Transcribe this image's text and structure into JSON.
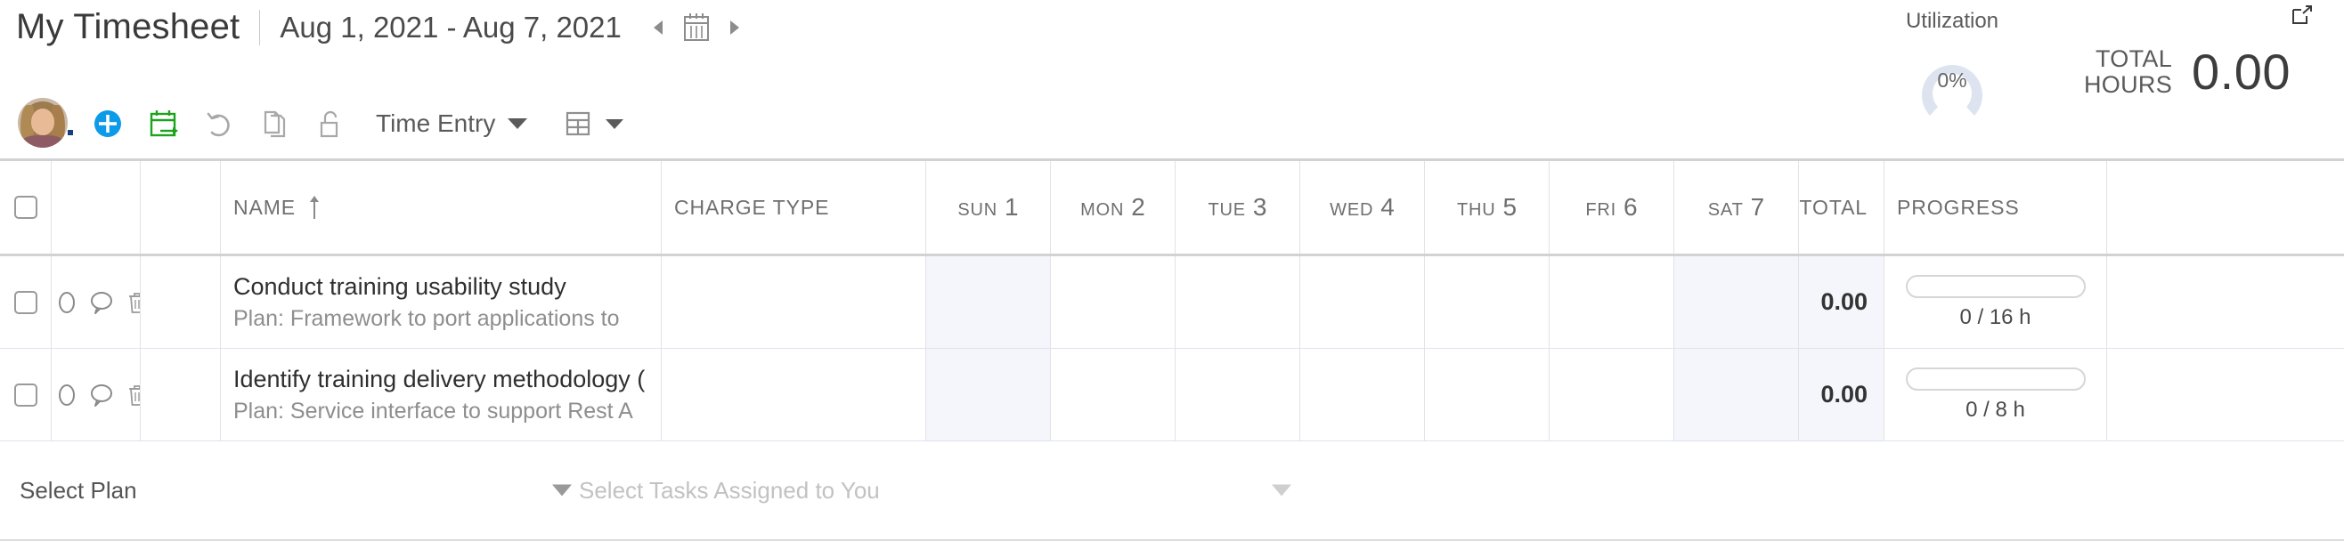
{
  "header": {
    "app_title": "My Timesheet",
    "date_range": "Aug 1, 2021 - Aug 7, 2021",
    "prev_icon": "chevron-left-icon",
    "calendar_icon": "calendar-icon",
    "next_icon": "chevron-right-icon",
    "expand_icon": "expand-window-icon"
  },
  "utilization": {
    "label": "Utilization",
    "percent_text": "0%",
    "percent_value": 0,
    "arc_color": "#dde4f0"
  },
  "totals": {
    "label_line1": "TOTAL",
    "label_line2": "HOURS",
    "value": "0.00"
  },
  "toolbar": {
    "avatar_name": "user-avatar",
    "add_label": "add-entry",
    "add_color": "#0d9ae8",
    "calendar_label": "copy-from-calendar",
    "calendar_color": "#1ca21c",
    "undo_label": "undo",
    "copy_label": "copy",
    "lock_label": "lock",
    "view_dropdown": "Time Entry",
    "grid_dropdown_label": "layout-options"
  },
  "grid": {
    "columns": {
      "name": "NAME",
      "charge_type": "CHARGE TYPE",
      "total": "TOTAL",
      "progress": "PROGRESS"
    },
    "days": [
      {
        "dow": "SUN",
        "num": "1",
        "weekend": true
      },
      {
        "dow": "MON",
        "num": "2",
        "weekend": false
      },
      {
        "dow": "TUE",
        "num": "3",
        "weekend": false
      },
      {
        "dow": "WED",
        "num": "4",
        "weekend": false
      },
      {
        "dow": "THU",
        "num": "5",
        "weekend": false
      },
      {
        "dow": "FRI",
        "num": "6",
        "weekend": false
      },
      {
        "dow": "SAT",
        "num": "7",
        "weekend": true
      }
    ],
    "rows": [
      {
        "task": "Conduct training usability study",
        "plan": "Plan: Framework to port applications to",
        "charge_type": "",
        "sun": "",
        "mon": "",
        "tue": "",
        "wed": "",
        "thu": "",
        "fri": "",
        "sat": "",
        "total": "0.00",
        "progress_text": "0 / 16 h",
        "progress_pct": 0
      },
      {
        "task": "Identify training delivery methodology (",
        "plan": "Plan: Service interface to support Rest A",
        "charge_type": "",
        "sun": "",
        "mon": "",
        "tue": "",
        "wed": "",
        "thu": "",
        "fri": "",
        "sat": "",
        "total": "0.00",
        "progress_text": "0 / 8 h",
        "progress_pct": 0
      }
    ]
  },
  "footer": {
    "select_plan": "Select Plan",
    "select_tasks": "Select Tasks Assigned to You"
  }
}
